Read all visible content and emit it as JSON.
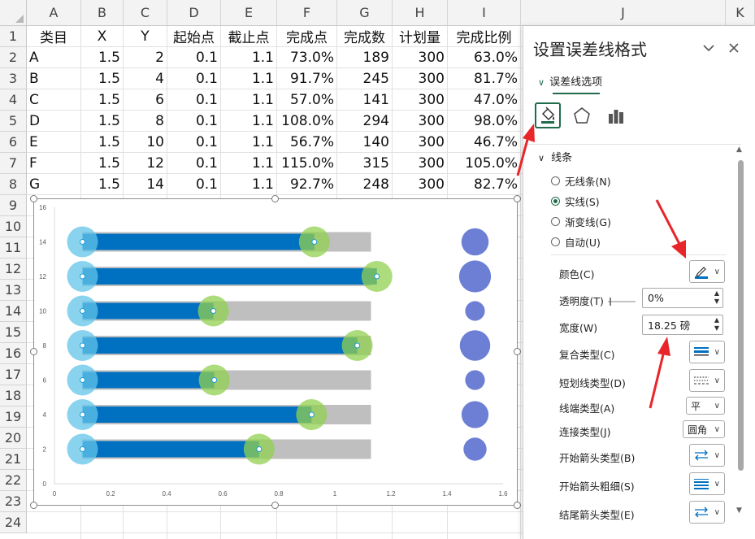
{
  "columns": [
    "A",
    "B",
    "C",
    "D",
    "E",
    "F",
    "G",
    "H",
    "I",
    "J",
    "K"
  ],
  "rows": [
    "1",
    "2",
    "3",
    "4",
    "5",
    "6",
    "7",
    "8",
    "9",
    "10",
    "11",
    "12",
    "13",
    "14",
    "15",
    "16",
    "17",
    "18",
    "19",
    "20",
    "21",
    "22",
    "23",
    "24"
  ],
  "table": {
    "headers": [
      "类目",
      "X",
      "Y",
      "起始点",
      "截止点",
      "完成点",
      "完成数",
      "计划量",
      "完成比例"
    ],
    "data": [
      [
        "A",
        "1.5",
        "2",
        "0.1",
        "1.1",
        "73.0%",
        "189",
        "300",
        "63.0%"
      ],
      [
        "B",
        "1.5",
        "4",
        "0.1",
        "1.1",
        "91.7%",
        "245",
        "300",
        "81.7%"
      ],
      [
        "C",
        "1.5",
        "6",
        "0.1",
        "1.1",
        "57.0%",
        "141",
        "300",
        "47.0%"
      ],
      [
        "D",
        "1.5",
        "8",
        "0.1",
        "1.1",
        "108.0%",
        "294",
        "300",
        "98.0%"
      ],
      [
        "E",
        "1.5",
        "10",
        "0.1",
        "1.1",
        "56.7%",
        "140",
        "300",
        "46.7%"
      ],
      [
        "F",
        "1.5",
        "12",
        "0.1",
        "1.1",
        "115.0%",
        "315",
        "300",
        "105.0%"
      ],
      [
        "G",
        "1.5",
        "14",
        "0.1",
        "1.1",
        "92.7%",
        "248",
        "300",
        "82.7%"
      ]
    ]
  },
  "chart_data": {
    "type": "scatter",
    "xlim": [
      0,
      1.6
    ],
    "ylim": [
      0,
      16
    ],
    "x_ticks": [
      "0",
      "0.2",
      "0.4",
      "0.6",
      "0.8",
      "1",
      "1.2",
      "1.4",
      "1.6"
    ],
    "y_ticks": [
      "0",
      "2",
      "4",
      "6",
      "8",
      "10",
      "12",
      "14",
      "16"
    ],
    "colors": {
      "plan": "#bfbfbf",
      "progress": "#0070c0",
      "start": "#61c4e9",
      "end": "#92d050",
      "bubble": "#6d7fd4"
    },
    "rows": [
      {
        "y": 2,
        "start": 0.1,
        "end": 1.1,
        "done": 0.73,
        "bubble_x": 1.5,
        "ratio": 0.63
      },
      {
        "y": 4,
        "start": 0.1,
        "end": 1.1,
        "done": 0.917,
        "bubble_x": 1.5,
        "ratio": 0.817
      },
      {
        "y": 6,
        "start": 0.1,
        "end": 1.1,
        "done": 0.57,
        "bubble_x": 1.5,
        "ratio": 0.47
      },
      {
        "y": 8,
        "start": 0.1,
        "end": 1.1,
        "done": 1.08,
        "bubble_x": 1.5,
        "ratio": 0.98
      },
      {
        "y": 10,
        "start": 0.1,
        "end": 1.1,
        "done": 0.567,
        "bubble_x": 1.5,
        "ratio": 0.467
      },
      {
        "y": 12,
        "start": 0.1,
        "end": 1.1,
        "done": 1.15,
        "bubble_x": 1.5,
        "ratio": 1.05
      },
      {
        "y": 14,
        "start": 0.1,
        "end": 1.1,
        "done": 0.927,
        "bubble_x": 1.5,
        "ratio": 0.827
      }
    ]
  },
  "pane": {
    "title": "设置误差线格式",
    "tab_label": "误差线选项",
    "section": "线条",
    "radios": [
      {
        "label": "无线条(N)",
        "checked": false
      },
      {
        "label": "实线(S)",
        "checked": true
      },
      {
        "label": "渐变线(G)",
        "checked": false
      },
      {
        "label": "自动(U)",
        "checked": false
      }
    ],
    "props": {
      "color": "颜色(C)",
      "transparency": "透明度(T)",
      "transparency_value": "0%",
      "width": "宽度(W)",
      "width_value": "18.25 磅",
      "compound": "复合类型(C)",
      "dash": "短划线类型(D)",
      "cap": "线端类型(A)",
      "cap_value": "平",
      "join": "连接类型(J)",
      "join_value": "圆角",
      "begin_arrow_type": "开始箭头类型(B)",
      "begin_arrow_size": "开始箭头粗细(S)",
      "end_arrow_type": "结尾箭头类型(E)"
    },
    "colors": {
      "accent": "#1f6b4a",
      "line_color": "#0070c0",
      "annotation": "#e8262a"
    }
  }
}
